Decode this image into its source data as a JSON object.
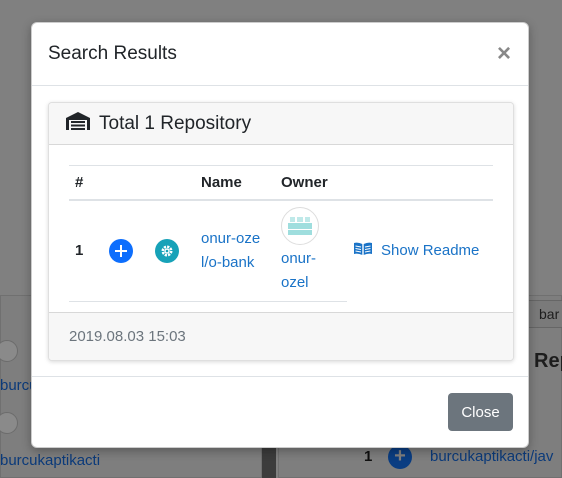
{
  "background": {
    "left_items": [
      {
        "label": "burcuk"
      },
      {
        "label": "burcukaptikacti"
      }
    ],
    "right_tab": "bar",
    "right_heading": "Rep",
    "right_row": {
      "index": "1",
      "link": "burcukaptikacti/jav"
    }
  },
  "modal": {
    "title": "Search Results",
    "close_symbol": "×",
    "card": {
      "header_icon": "warehouse-icon",
      "header": "Total 1 Repository",
      "columns": [
        "#",
        "",
        "",
        "Name",
        "Owner",
        ""
      ],
      "rows": [
        {
          "index": "1",
          "add_icon": "plus-circle-icon",
          "settings_icon": "gear-icon",
          "name": "onur-ozel/o-bank",
          "owner": "onur-ozel",
          "readme_label": "Show Readme",
          "readme_icon": "book-open-icon"
        }
      ],
      "footer": "2019.08.03 15:03"
    },
    "close_button": "Close"
  },
  "colors": {
    "link": "#1a73c7",
    "add_button": "#0d6efd",
    "settings_button": "#17a2b8",
    "close_button": "#6c757d"
  }
}
